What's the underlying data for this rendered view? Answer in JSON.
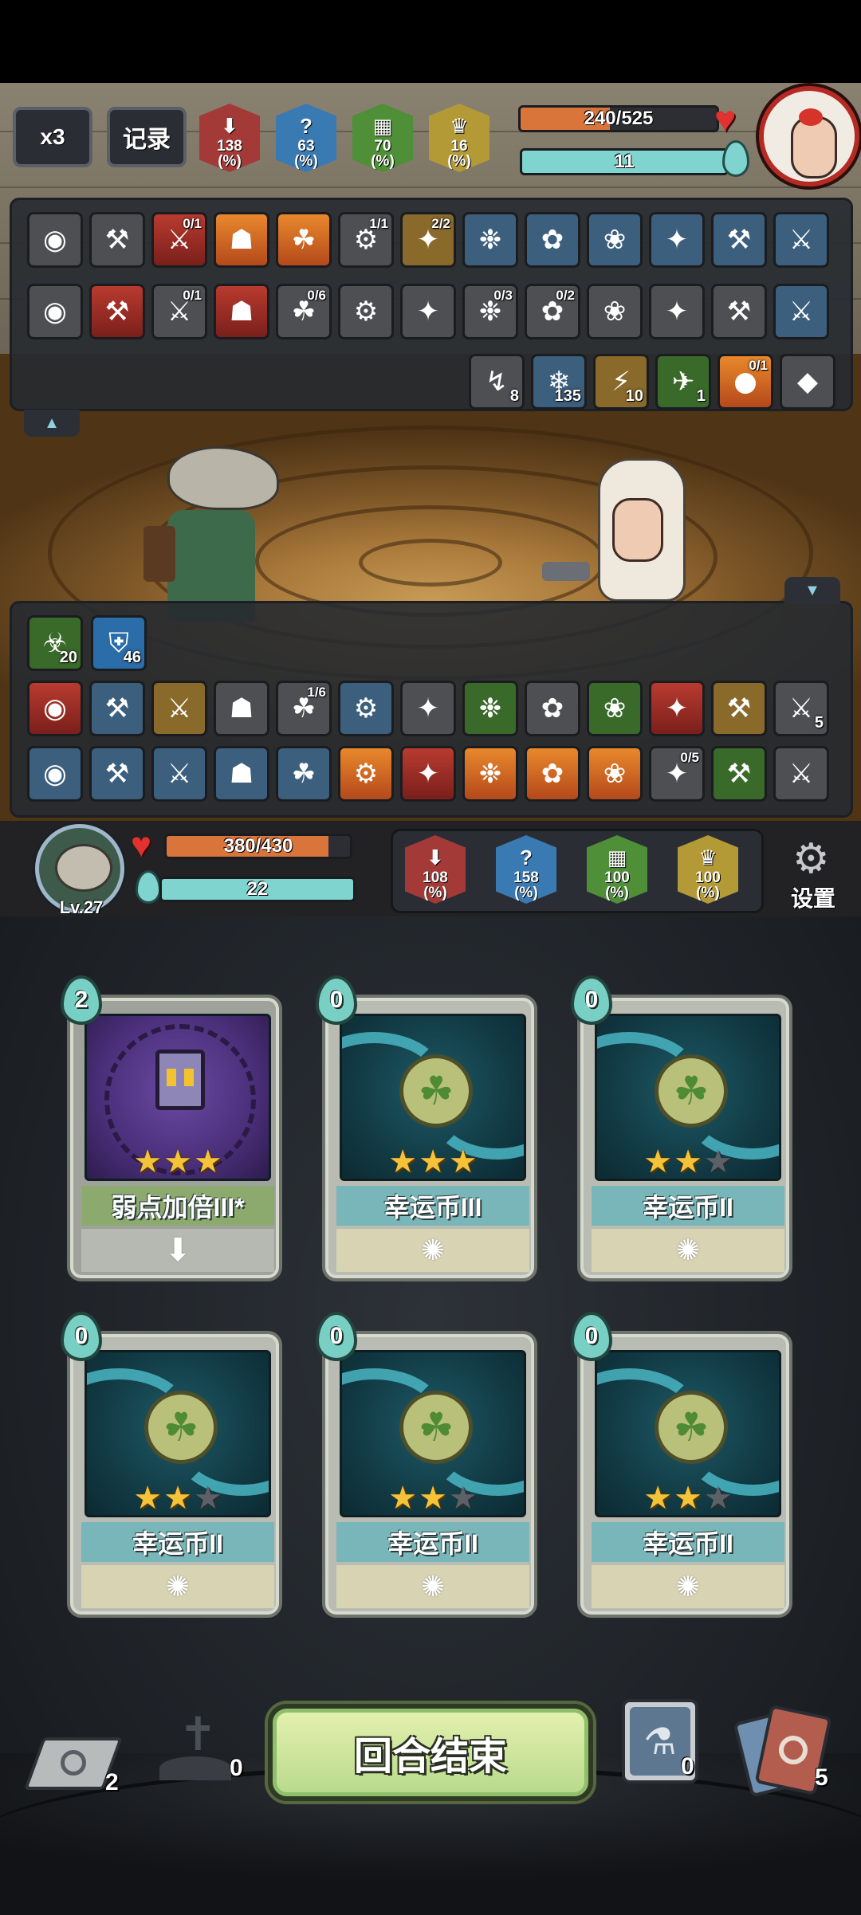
{
  "enemy": {
    "speed_label": "x3",
    "log_label": "记录",
    "stats": [
      {
        "icon": "sword-icon",
        "value": "138",
        "unit": "(%)",
        "color": "#a33a38"
      },
      {
        "icon": "question-icon",
        "value": "63",
        "unit": "(%)",
        "color": "#3a7ab3"
      },
      {
        "icon": "armor-icon",
        "value": "70",
        "unit": "(%)",
        "color": "#4f8f38"
      },
      {
        "icon": "crown-icon",
        "value": "16",
        "unit": "(%)",
        "color": "#b39a36"
      }
    ],
    "hp_text": "240/525",
    "hp_ratio": 0.457,
    "energy_text": "11",
    "energy_ratio": 1.0,
    "relics_row1": [
      "",
      "",
      "0/1",
      "",
      "",
      "1/1",
      "2/2",
      "",
      "",
      "",
      "",
      "",
      ""
    ],
    "relics_row2": [
      "",
      "",
      "0/1",
      "",
      "0/6",
      "",
      "",
      "0/3",
      "0/2",
      "",
      "",
      "",
      ""
    ],
    "status_effects": [
      {
        "icon": "down-arrow-icon",
        "value": "8"
      },
      {
        "icon": "snowflake-icon",
        "value": "135"
      },
      {
        "icon": "lightning-icon",
        "value": "10"
      },
      {
        "icon": "wing-icon",
        "value": "1"
      },
      {
        "icon": "bag-icon",
        "value": "0/1"
      },
      {
        "icon": "stone-icon",
        "value": ""
      }
    ]
  },
  "player": {
    "buffs": [
      {
        "icon": "poison-icon",
        "value": "20"
      },
      {
        "icon": "shield-icon",
        "value": "46"
      }
    ],
    "relics_row1": [
      "",
      "",
      "",
      "",
      "1/6",
      "",
      "",
      "",
      "",
      "",
      "",
      "",
      "5"
    ],
    "relics_row2": [
      "",
      "",
      "",
      "",
      "",
      "",
      "",
      "",
      "",
      "",
      "0/5",
      "",
      ""
    ],
    "level": "Lv.27",
    "hp_text": "380/430",
    "hp_ratio": 0.884,
    "energy_text": "22",
    "energy_ratio": 1.0,
    "stats": [
      {
        "icon": "sword-icon",
        "value": "108",
        "unit": "(%)",
        "color": "#a33a38"
      },
      {
        "icon": "question-icon",
        "value": "158",
        "unit": "(%)",
        "color": "#3a7ab3"
      },
      {
        "icon": "armor-icon",
        "value": "100",
        "unit": "(%)",
        "color": "#4f8f38"
      },
      {
        "icon": "crown-icon",
        "value": "100",
        "unit": "(%)",
        "color": "#b39a36"
      }
    ],
    "settings_label": "设置"
  },
  "hand": [
    {
      "cost": "2",
      "name": "弱点加倍III*",
      "stars": 3,
      "art": "weakness-double",
      "locked": true
    },
    {
      "cost": "0",
      "name": "幸运币III",
      "stars": 3,
      "art": "lucky-coin",
      "locked": false
    },
    {
      "cost": "0",
      "name": "幸运币II",
      "stars": 2,
      "art": "lucky-coin",
      "locked": false
    },
    {
      "cost": "0",
      "name": "幸运币II",
      "stars": 2,
      "art": "lucky-coin",
      "locked": false
    },
    {
      "cost": "0",
      "name": "幸运币II",
      "stars": 2,
      "art": "lucky-coin",
      "locked": false
    },
    {
      "cost": "0",
      "name": "幸运币II",
      "stars": 2,
      "art": "lucky-coin",
      "locked": false
    }
  ],
  "footer": {
    "draw_pile_count": "2",
    "grave_count": "0",
    "end_turn_label": "回合结束",
    "potion_count": "0",
    "discard_pile_count": "5"
  }
}
